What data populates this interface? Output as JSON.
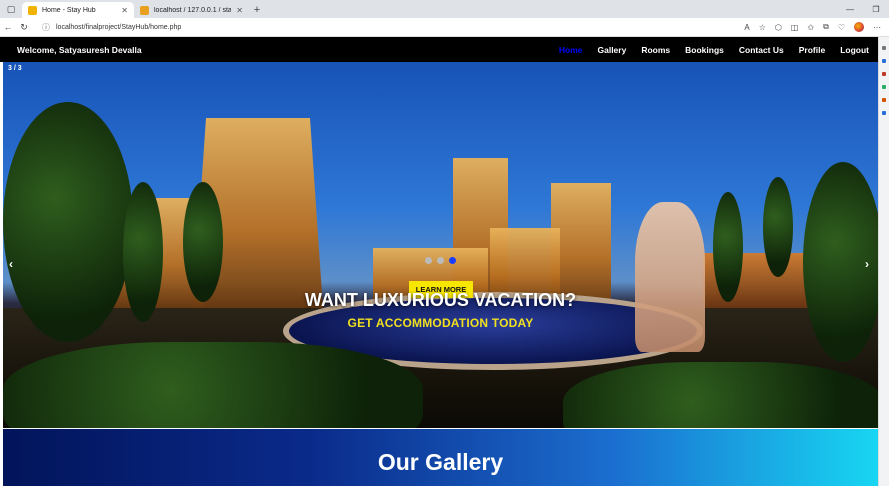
{
  "browser": {
    "tabs": [
      {
        "title": "Home - Stay Hub",
        "active": true,
        "favicon_color": "#f0b400"
      },
      {
        "title": "localhost / 127.0.0.1 / stayhub / ...",
        "active": false,
        "favicon_color": "#e8a020"
      }
    ],
    "url": "localhost/finalproject/StayHub/home.php"
  },
  "site": {
    "welcome": "Welcome, Satyasuresh Devalla",
    "menu": [
      {
        "label": "Home",
        "active": true
      },
      {
        "label": "Gallery",
        "active": false
      },
      {
        "label": "Rooms",
        "active": false
      },
      {
        "label": "Bookings",
        "active": false
      },
      {
        "label": "Contact Us",
        "active": false
      },
      {
        "label": "Profile",
        "active": false
      },
      {
        "label": "Logout",
        "active": false
      }
    ]
  },
  "hero": {
    "slide_counter": "3 / 3",
    "prev_arrow": "‹",
    "next_arrow": "›",
    "dots": 3,
    "active_dot": 2,
    "button_label": "LEARN MORE",
    "title": "WANT LUXURIOUS VACATION?",
    "subtitle": "GET ACCOMMODATION TODAY"
  },
  "gallery": {
    "title": "Our Gallery"
  },
  "colors": {
    "nav_bg": "#000000",
    "active_link": "#0000ff",
    "button_bg": "#f7e600",
    "subtitle": "#f0e020"
  }
}
